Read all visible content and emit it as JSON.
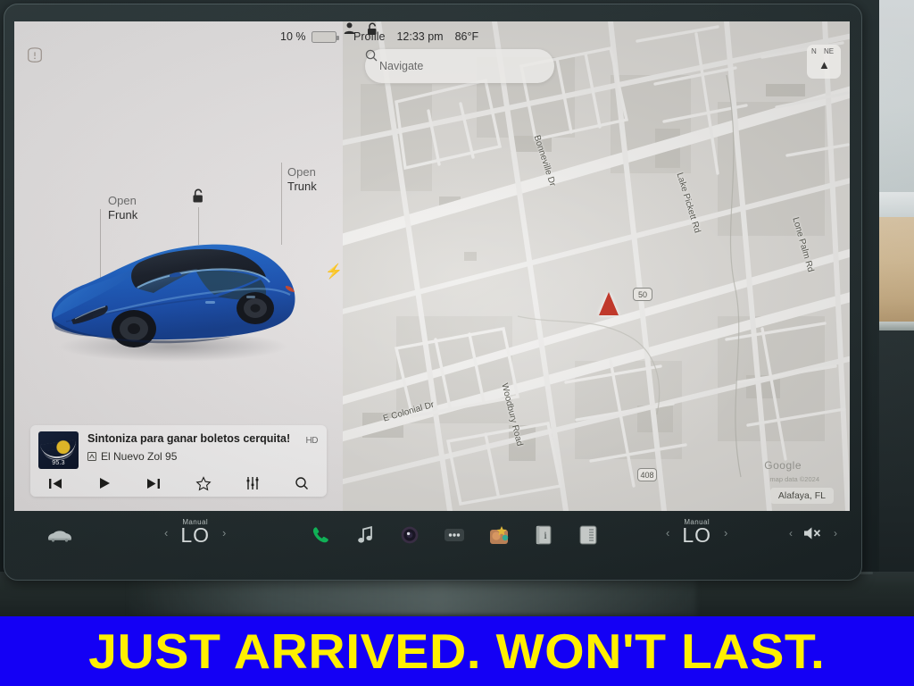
{
  "status_bar": {
    "battery_percent": "10 %",
    "lock_icon": "unlocked-padlock-icon",
    "profile_icon": "person-icon",
    "profile_label": "Profile",
    "time": "12:33 pm",
    "temperature": "86°F"
  },
  "car_panel": {
    "tpms_icon": "tire-pressure-warning-icon",
    "lock_icon": "unlocked-padlock-icon",
    "charge_port_icon": "charge-bolt-icon",
    "callouts": [
      {
        "line1": "Open",
        "line2": "Frunk"
      },
      {
        "line1": "Open",
        "line2": "Trunk"
      }
    ]
  },
  "media": {
    "title": "Sintoniza para ganar boletos cerquita!",
    "station": "El Nuevo Zol 95",
    "station_icon": "radio-hd-icon",
    "hd_badge": "HD",
    "album_art_text": "95.3",
    "controls": [
      {
        "name": "previous-track-button",
        "glyph": "⏮"
      },
      {
        "name": "play-button",
        "glyph": "▶"
      },
      {
        "name": "next-track-button",
        "glyph": "⏭"
      },
      {
        "name": "favorite-button",
        "glyph": "☆"
      },
      {
        "name": "equalizer-button",
        "glyph": "⦀"
      },
      {
        "name": "search-media-button",
        "glyph": "⚲"
      }
    ]
  },
  "map": {
    "search_placeholder": "Navigate",
    "search_icon": "search-icon",
    "compass": {
      "north": "N",
      "northeast": "NE",
      "arrow": "▲"
    },
    "highway_shields": [
      "50",
      "408"
    ],
    "streets": [
      "Bonneville Dr",
      "Lake Pickett Rd",
      "Lone Palm Rd",
      "E Colonial Dr",
      "Woodbury Road"
    ],
    "attribution": "Google",
    "attribution_data": "map data ©2024",
    "city": "Alafaya, FL"
  },
  "control_bar": {
    "car_icon": "car-icon",
    "climate_left": {
      "mode": "Manual",
      "temp": "LO"
    },
    "climate_right": {
      "mode": "Manual",
      "temp": "LO"
    },
    "chevron_left": "‹",
    "chevron_right": "›",
    "volume_mute_icon": "speaker-muted-icon",
    "apps": [
      {
        "name": "phone-icon"
      },
      {
        "name": "music-icon"
      },
      {
        "name": "camera-icon"
      },
      {
        "name": "more-options-icon"
      },
      {
        "name": "apps-grid-icon"
      },
      {
        "name": "info-icon"
      },
      {
        "name": "card-icon"
      }
    ]
  },
  "banner": {
    "text": "JUST ARRIVED. WON'T LAST.",
    "background_color": "#1400f5",
    "text_color": "#ffef00"
  }
}
